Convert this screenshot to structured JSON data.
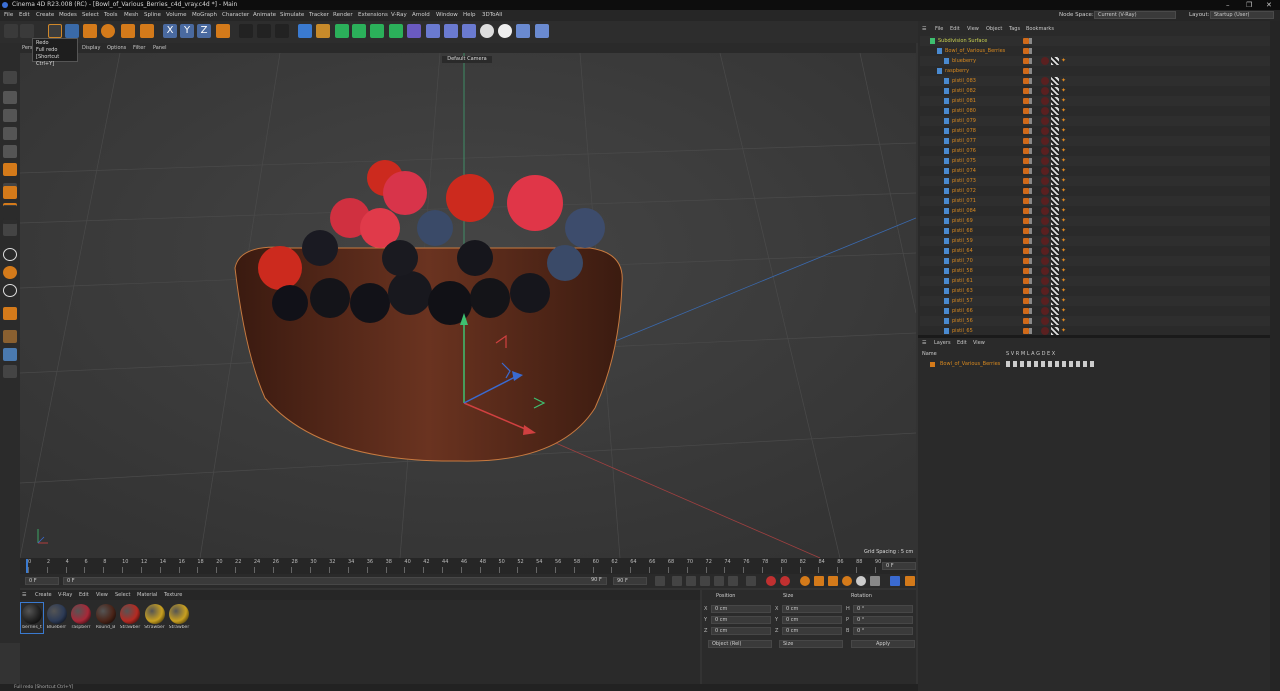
{
  "window": {
    "title": "Cinema 4D R23.008 (RC) - [Bowl_of_Various_Berries_c4d_vray.c4d *] - Main"
  },
  "menubar": {
    "items": [
      "File",
      "Edit",
      "Create",
      "Modes",
      "Select",
      "Tools",
      "Mesh",
      "Spline",
      "Volume",
      "MoGraph",
      "Character",
      "Animate",
      "Simulate",
      "Tracker",
      "Render",
      "Extensions",
      "V-Ray",
      "Arnold",
      "Window",
      "Help",
      "3DToAll"
    ],
    "node_space_label": "Node Space:",
    "node_space_value": "Current (V-Ray)",
    "layout_label": "Layout:",
    "layout_value": "Startup (User)"
  },
  "tooltip": {
    "line1": "Redo",
    "line2": "Full redo",
    "line3": "[Shortcut Ctrl+Y]"
  },
  "viewport": {
    "menu": [
      "View",
      "Cameras",
      "Display",
      "Options",
      "Filter",
      "Panel"
    ],
    "menu_visible_prefix": "Pers",
    "camera_label": "Default Camera",
    "grid_spacing": "Grid Spacing : 5 cm"
  },
  "timeline": {
    "ticks": [
      "0",
      "2",
      "4",
      "6",
      "8",
      "10",
      "12",
      "14",
      "16",
      "18",
      "20",
      "22",
      "24",
      "26",
      "28",
      "30",
      "32",
      "34",
      "36",
      "38",
      "40",
      "42",
      "44",
      "46",
      "48",
      "50",
      "52",
      "54",
      "56",
      "58",
      "60",
      "62",
      "64",
      "66",
      "68",
      "70",
      "72",
      "74",
      "76",
      "78",
      "80",
      "82",
      "84",
      "86",
      "88",
      "90"
    ],
    "current_frame_right": "0 F",
    "start_field": "0 F",
    "start_field2": "0 F",
    "end_field": "90 F",
    "end_field2": "90 F"
  },
  "materials": {
    "menu": [
      "Create",
      "V-Ray",
      "Edit",
      "View",
      "Select",
      "Material",
      "Texture"
    ],
    "items": [
      {
        "label": "berries_t",
        "color": "#222222"
      },
      {
        "label": "Blueberr",
        "color": "#2c3a55"
      },
      {
        "label": "raspberr",
        "color": "#a82838"
      },
      {
        "label": "Round_B",
        "color": "#4a2418"
      },
      {
        "label": "Strawber",
        "color": "#b52a22"
      },
      {
        "label": "Strawber",
        "color": "#c9a020"
      },
      {
        "label": "Strawber",
        "color": "#c9a020"
      }
    ]
  },
  "coordinates": {
    "headers": {
      "position": "Position",
      "size": "Size",
      "rotation": "Rotation"
    },
    "rows": [
      {
        "axis": "X",
        "pos": "0 cm",
        "size_axis": "X",
        "size": "0 cm",
        "rot_axis": "H",
        "rot": "0 °"
      },
      {
        "axis": "Y",
        "pos": "0 cm",
        "size_axis": "Y",
        "size": "0 cm",
        "rot_axis": "P",
        "rot": "0 °"
      },
      {
        "axis": "Z",
        "pos": "0 cm",
        "size_axis": "Z",
        "size": "0 cm",
        "rot_axis": "B",
        "rot": "0 °"
      }
    ],
    "mode_select": "Object (Rel)",
    "size_select": "Size",
    "apply_label": "Apply"
  },
  "object_manager": {
    "menu": [
      "File",
      "Edit",
      "View",
      "Object",
      "Tags",
      "Bookmarks"
    ],
    "rows": [
      {
        "name": "Subdivision Surface",
        "indent": 0,
        "color": "#c8d050"
      },
      {
        "name": "Bowl_of_Various_Berries",
        "indent": 1,
        "color": "#d8891f"
      },
      {
        "name": "blueberry",
        "indent": 2,
        "color": "#d8891f"
      },
      {
        "name": "raspberry",
        "indent": 1,
        "color": "#d8891f"
      },
      {
        "name": "pistil_083",
        "indent": 2,
        "color": "#d8891f"
      },
      {
        "name": "pistil_082",
        "indent": 2,
        "color": "#d8891f"
      },
      {
        "name": "pistil_081",
        "indent": 2,
        "color": "#d8891f"
      },
      {
        "name": "pistil_080",
        "indent": 2,
        "color": "#d8891f"
      },
      {
        "name": "pistil_079",
        "indent": 2,
        "color": "#d8891f"
      },
      {
        "name": "pistil_078",
        "indent": 2,
        "color": "#d8891f"
      },
      {
        "name": "pistil_077",
        "indent": 2,
        "color": "#d8891f"
      },
      {
        "name": "pistil_076",
        "indent": 2,
        "color": "#d8891f"
      },
      {
        "name": "pistil_075",
        "indent": 2,
        "color": "#d8891f"
      },
      {
        "name": "pistil_074",
        "indent": 2,
        "color": "#d8891f"
      },
      {
        "name": "pistil_073",
        "indent": 2,
        "color": "#d8891f"
      },
      {
        "name": "pistil_072",
        "indent": 2,
        "color": "#d8891f"
      },
      {
        "name": "pistil_071",
        "indent": 2,
        "color": "#d8891f"
      },
      {
        "name": "pistil_084",
        "indent": 2,
        "color": "#d8891f"
      },
      {
        "name": "pistil_69",
        "indent": 2,
        "color": "#d8891f"
      },
      {
        "name": "pistil_68",
        "indent": 2,
        "color": "#d8891f"
      },
      {
        "name": "pistil_59",
        "indent": 2,
        "color": "#d8891f"
      },
      {
        "name": "pistil_64",
        "indent": 2,
        "color": "#d8891f"
      },
      {
        "name": "pistil_70",
        "indent": 2,
        "color": "#d8891f"
      },
      {
        "name": "pistil_58",
        "indent": 2,
        "color": "#d8891f"
      },
      {
        "name": "pistil_61",
        "indent": 2,
        "color": "#d8891f"
      },
      {
        "name": "pistil_63",
        "indent": 2,
        "color": "#d8891f"
      },
      {
        "name": "pistil_57",
        "indent": 2,
        "color": "#d8891f"
      },
      {
        "name": "pistil_66",
        "indent": 2,
        "color": "#d8891f"
      },
      {
        "name": "pistil_56",
        "indent": 2,
        "color": "#d8891f"
      },
      {
        "name": "pistil_65",
        "indent": 2,
        "color": "#d8891f"
      }
    ]
  },
  "layers": {
    "menu": [
      "Layers",
      "Edit",
      "View"
    ],
    "header_name": "Name",
    "header_cols": "S V R M L A G D E X",
    "row_name": "Bowl_of_Various_Berries"
  },
  "status": {
    "text": "Full redo [Shortcut Ctrl+Y]"
  }
}
